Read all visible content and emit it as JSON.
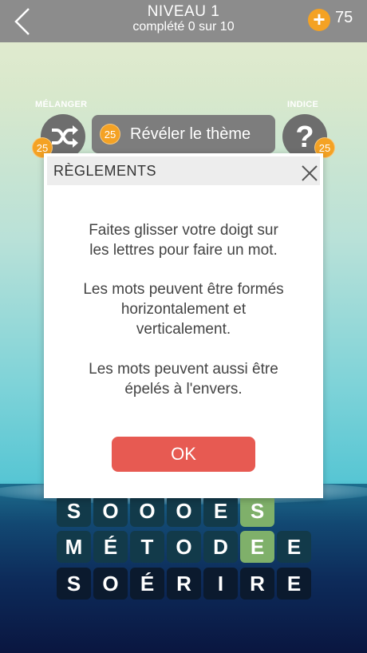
{
  "header": {
    "title": "NIVEAU 1",
    "subtitle": "complété 0 sur 10",
    "coins": "75"
  },
  "actions": {
    "shuffle_label": "MÉLANGER",
    "shuffle_cost": "25",
    "reveal_cost": "25",
    "reveal_label": "Révéler le thème",
    "hint_label": "INDICE",
    "hint_cost": "25"
  },
  "modal": {
    "title": "RÈGLEMENTS",
    "rule1_line1": "Faites glisser votre doigt sur",
    "rule1_line2": "les lettres pour faire un mot.",
    "rule2_line1": "Les mots peuvent être formés",
    "rule2_line2": "horizontalement et",
    "rule2_line3": "verticalement.",
    "rule3_line1": "Les mots peuvent aussi être",
    "rule3_line2": "épelés à l'envers.",
    "ok_label": "OK"
  },
  "grid": {
    "rows": [
      [
        "S",
        "O",
        "O",
        "O",
        "E",
        "S",
        ""
      ],
      [
        "M",
        "É",
        "T",
        "O",
        "D",
        "E",
        "E"
      ],
      [
        "S",
        "O",
        "É",
        "R",
        "I",
        "R",
        "E"
      ]
    ],
    "highlighted": [
      [
        0,
        5
      ],
      [
        1,
        5
      ]
    ]
  },
  "colors": {
    "accent": "#f4a224",
    "ok_button": "#e75a52",
    "highlight_tile": "#7fb06a"
  }
}
